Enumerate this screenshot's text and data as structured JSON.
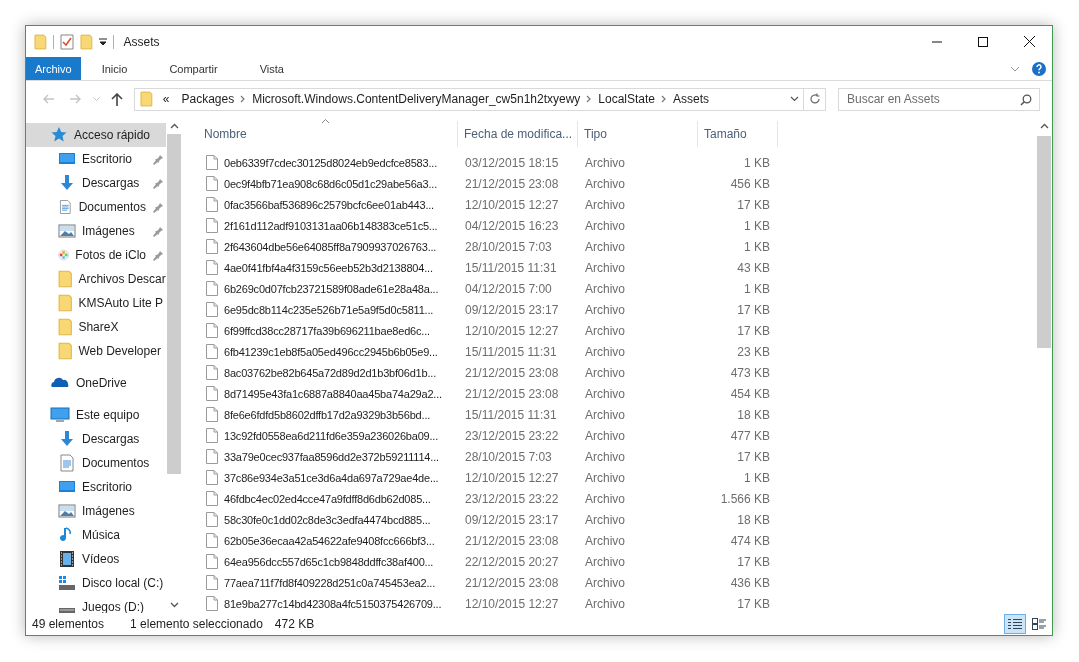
{
  "window": {
    "title": "Assets"
  },
  "ribbon_tabs": [
    {
      "label": "Archivo",
      "kind": "file"
    },
    {
      "label": "Inicio",
      "kind": "tab"
    },
    {
      "label": "Compartir",
      "kind": "tab"
    },
    {
      "label": "Vista",
      "kind": "tab"
    }
  ],
  "address_bar": {
    "overflow": "«",
    "path": [
      "Packages",
      "Microsoft.Windows.ContentDeliveryManager_cw5n1h2txyewy",
      "LocalState",
      "Assets"
    ]
  },
  "search": {
    "placeholder": "Buscar en Assets"
  },
  "sidebar": {
    "items": [
      {
        "label": "Acceso rápido",
        "kind": "star",
        "selected": true,
        "children": [
          {
            "label": "Escritorio",
            "kind": "desktop",
            "pinned": true,
            "selected": false
          },
          {
            "label": "Descargas",
            "kind": "download",
            "pinned": true,
            "selected": false
          },
          {
            "label": "Documentos",
            "kind": "document",
            "pinned": true,
            "selected": false
          },
          {
            "label": "Imágenes",
            "kind": "image",
            "pinned": true,
            "selected": false
          },
          {
            "label": "Fotos de iClo",
            "kind": "photos",
            "pinned": true,
            "selected": false
          },
          {
            "label": "Archivos Descar",
            "kind": "folder",
            "pinned": false,
            "selected": false
          },
          {
            "label": "KMSAuto Lite P",
            "kind": "folder",
            "pinned": false,
            "selected": false
          },
          {
            "label": "ShareX",
            "kind": "folder",
            "pinned": false,
            "selected": false
          },
          {
            "label": "Web Developer",
            "kind": "folder",
            "pinned": false,
            "selected": false
          }
        ]
      },
      {
        "label": "OneDrive",
        "kind": "cloud",
        "selected": false
      },
      {
        "label": "Este equipo",
        "kind": "computer",
        "selected": false,
        "children": [
          {
            "label": "Descargas",
            "kind": "download",
            "selected": false
          },
          {
            "label": "Documentos",
            "kind": "document",
            "selected": false
          },
          {
            "label": "Escritorio",
            "kind": "desktop",
            "selected": false
          },
          {
            "label": "Imágenes",
            "kind": "image",
            "selected": false
          },
          {
            "label": "Música",
            "kind": "music",
            "selected": false
          },
          {
            "label": "Vídeos",
            "kind": "video",
            "selected": false
          },
          {
            "label": "Disco local (C:)",
            "kind": "system-drive",
            "selected": false
          },
          {
            "label": "Juegos (D:)",
            "kind": "drive",
            "selected": false
          }
        ]
      }
    ]
  },
  "table": {
    "columns": [
      {
        "label": "Nombre",
        "sorted": true
      },
      {
        "label": "Fecha de modifica...",
        "sorted": false
      },
      {
        "label": "Tipo",
        "sorted": false
      },
      {
        "label": "Tamaño",
        "sorted": false
      }
    ],
    "rows": [
      {
        "name": "0eb6339f7cdec30125d8024eb9edcfce8583...",
        "modified": "03/12/2015 18:15",
        "type": "Archivo",
        "size": "1 KB"
      },
      {
        "name": "0ec9f4bfb71ea908c68d6c05d1c29abe56a3...",
        "modified": "21/12/2015 23:08",
        "type": "Archivo",
        "size": "456 KB"
      },
      {
        "name": "0fac3566baf536896c2579bcfc6ee01ab443...",
        "modified": "12/10/2015 12:27",
        "type": "Archivo",
        "size": "17 KB"
      },
      {
        "name": "2f161d112adf9103131aa06b148383ce51c5...",
        "modified": "04/12/2015 16:23",
        "type": "Archivo",
        "size": "1 KB"
      },
      {
        "name": "2f643604dbe56e64085ff8a7909937026763...",
        "modified": "28/10/2015 7:03",
        "type": "Archivo",
        "size": "1 KB"
      },
      {
        "name": "4ae0f41fbf4a4f3159c56eeb52b3d2138804...",
        "modified": "15/11/2015 11:31",
        "type": "Archivo",
        "size": "43 KB"
      },
      {
        "name": "6b269c0d07fcb23721589f08ade61e28a48a...",
        "modified": "04/12/2015 7:00",
        "type": "Archivo",
        "size": "1 KB"
      },
      {
        "name": "6e95dc8b114c235e526b71e5a9f5d0c5811...",
        "modified": "09/12/2015 23:17",
        "type": "Archivo",
        "size": "17 KB"
      },
      {
        "name": "6f99ffcd38cc28717fa39b696211bae8ed6c...",
        "modified": "12/10/2015 12:27",
        "type": "Archivo",
        "size": "17 KB"
      },
      {
        "name": "6fb41239c1eb8f5a05ed496cc2945b6b05e9...",
        "modified": "15/11/2015 11:31",
        "type": "Archivo",
        "size": "23 KB"
      },
      {
        "name": "8ac03762be82b645a72d89d2d1b3bf06d1b...",
        "modified": "21/12/2015 23:08",
        "type": "Archivo",
        "size": "473 KB"
      },
      {
        "name": "8d71495e43fa1c6887a8840aa45ba74a29a2...",
        "modified": "21/12/2015 23:08",
        "type": "Archivo",
        "size": "454 KB"
      },
      {
        "name": "8fe6e6fdfd5b8602dffb17d2a9329b3b56bd...",
        "modified": "15/11/2015 11:31",
        "type": "Archivo",
        "size": "18 KB"
      },
      {
        "name": "13c92fd0558ea6d211fd6e359a236026ba09...",
        "modified": "23/12/2015 23:22",
        "type": "Archivo",
        "size": "477 KB"
      },
      {
        "name": "33a79e0cec937faa8596dd2e372b59211114...",
        "modified": "28/10/2015 7:03",
        "type": "Archivo",
        "size": "17 KB"
      },
      {
        "name": "37c86e934e3a51ce3d6a4da697a729ae4de...",
        "modified": "12/10/2015 12:27",
        "type": "Archivo",
        "size": "1 KB"
      },
      {
        "name": "46fdbc4ec02ed4cce47a9fdff8d6db62d085...",
        "modified": "23/12/2015 23:22",
        "type": "Archivo",
        "size": "1.566 KB"
      },
      {
        "name": "58c30fe0c1dd02c8de3c3edfa4474bcd885...",
        "modified": "09/12/2015 23:17",
        "type": "Archivo",
        "size": "18 KB"
      },
      {
        "name": "62b05e36ecaa42a54622afe9408fcc666bf3...",
        "modified": "21/12/2015 23:08",
        "type": "Archivo",
        "size": "474 KB"
      },
      {
        "name": "64ea956dcc557d65c1cb9848ddffc38af400...",
        "modified": "22/12/2015 20:27",
        "type": "Archivo",
        "size": "17 KB"
      },
      {
        "name": "77aea711f7fd8f409228d251c0a745453ea2...",
        "modified": "21/12/2015 23:08",
        "type": "Archivo",
        "size": "436 KB"
      },
      {
        "name": "81e9ba277c14bd42308a4fc5150375426709...",
        "modified": "12/10/2015 12:27",
        "type": "Archivo",
        "size": "17 KB"
      }
    ]
  },
  "status_bar": {
    "count": "49 elementos",
    "selection": "1 elemento seleccionado",
    "selection_size": "472 KB",
    "view_buttons": [
      {
        "kind": "details",
        "selected": true
      },
      {
        "kind": "tiles",
        "selected": false
      }
    ]
  }
}
